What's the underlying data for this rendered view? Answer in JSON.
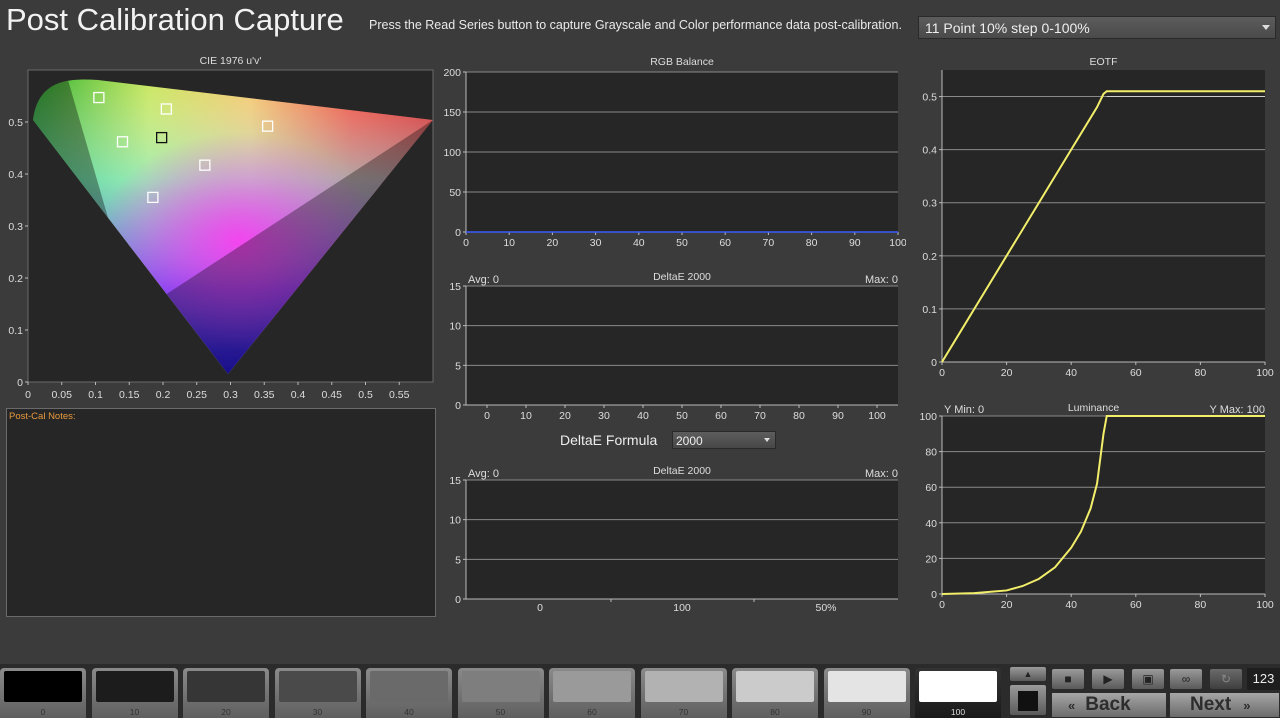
{
  "header": {
    "title": "Post Calibration Capture",
    "instruction": "Press the Read Series button to capture Grayscale and Color performance data post-calibration.",
    "series_select": "11 Point 10% step 0-100%"
  },
  "notes": {
    "label": "Post-Cal Notes:"
  },
  "deltae_formula": {
    "label": "DeltaE Formula",
    "value": "2000"
  },
  "colors": {
    "panel_bg": "#262626",
    "grid": "#8a8a8a",
    "curve": "#f2ee6a",
    "rgb_line": "#3a5cff",
    "notes_label": "#e89a3c"
  },
  "chart_data": [
    {
      "type": "scatter",
      "title": "CIE 1976 u'v'",
      "xticks": [
        "0",
        "0.05",
        "0.1",
        "0.15",
        "0.2",
        "0.25",
        "0.3",
        "0.35",
        "0.4",
        "0.45",
        "0.5",
        "0.55"
      ],
      "yticks": [
        "0",
        "0.1",
        "0.2",
        "0.3",
        "0.4",
        "0.5"
      ],
      "xlim": [
        0,
        0.6
      ],
      "ylim": [
        0,
        0.6
      ],
      "points": [
        {
          "u": 0.105,
          "v": 0.547
        },
        {
          "u": 0.205,
          "v": 0.525
        },
        {
          "u": 0.14,
          "v": 0.462
        },
        {
          "u": 0.198,
          "v": 0.47,
          "target": true
        },
        {
          "u": 0.355,
          "v": 0.492
        },
        {
          "u": 0.262,
          "v": 0.417
        },
        {
          "u": 0.185,
          "v": 0.355
        }
      ]
    },
    {
      "type": "line",
      "title": "RGB Balance",
      "xticks": [
        "0",
        "10",
        "20",
        "30",
        "40",
        "50",
        "60",
        "70",
        "80",
        "90",
        "100"
      ],
      "yticks": [
        "0",
        "50",
        "100",
        "150",
        "200"
      ],
      "xlim": [
        0,
        100
      ],
      "ylim": [
        0,
        200
      ],
      "series": [
        {
          "x": [
            0,
            100
          ],
          "y": [
            0,
            0
          ]
        }
      ]
    },
    {
      "type": "bar",
      "title": "DeltaE 2000",
      "avg_label": "Avg: 0",
      "max_label": "Max: 0",
      "xticks": [
        "0",
        "10",
        "20",
        "30",
        "40",
        "50",
        "60",
        "70",
        "80",
        "90",
        "100"
      ],
      "yticks": [
        "0",
        "5",
        "10",
        "15"
      ],
      "ylim": [
        0,
        15
      ],
      "values": [
        0,
        0,
        0,
        0,
        0,
        0,
        0,
        0,
        0,
        0,
        0
      ]
    },
    {
      "type": "bar",
      "title": "DeltaE 2000",
      "avg_label": "Avg: 0",
      "max_label": "Max: 0",
      "categories": [
        "0",
        "100",
        "50%"
      ],
      "yticks": [
        "0",
        "5",
        "10",
        "15"
      ],
      "ylim": [
        0,
        15
      ],
      "values": [
        0,
        0,
        0
      ]
    },
    {
      "type": "line",
      "title": "EOTF",
      "xticks": [
        "0",
        "20",
        "40",
        "60",
        "80",
        "100"
      ],
      "yticks": [
        "0",
        "0.1",
        "0.2",
        "0.3",
        "0.4",
        "0.5"
      ],
      "xlim": [
        0,
        100
      ],
      "ylim": [
        0,
        0.55
      ],
      "series": [
        {
          "x": [
            0,
            5,
            10,
            20,
            30,
            40,
            48,
            50,
            51,
            60,
            80,
            100
          ],
          "y": [
            0,
            0.05,
            0.1,
            0.2,
            0.3,
            0.4,
            0.48,
            0.505,
            0.51,
            0.51,
            0.51,
            0.51
          ]
        },
        {
          "x": [
            51,
            100
          ],
          "y": [
            0.5,
            0.5
          ]
        }
      ]
    },
    {
      "type": "line",
      "title": "Luminance",
      "ymin_label": "Y Min: 0",
      "ymax_label": "Y Max: 100",
      "xticks": [
        "0",
        "20",
        "40",
        "60",
        "80",
        "100"
      ],
      "yticks": [
        "0",
        "20",
        "40",
        "60",
        "80",
        "100"
      ],
      "xlim": [
        0,
        100
      ],
      "ylim": [
        0,
        100
      ],
      "series": [
        {
          "x": [
            0,
            10,
            20,
            25,
            30,
            35,
            40,
            43,
            46,
            48,
            50,
            51,
            60,
            80,
            100
          ],
          "y": [
            0,
            0.5,
            2,
            4.5,
            8.5,
            15,
            26,
            35,
            48,
            62,
            90,
            100,
            100,
            100,
            100
          ]
        }
      ]
    }
  ],
  "swatches": [
    {
      "label": "0",
      "color": "#000000"
    },
    {
      "label": "10",
      "color": "#1c1c1c"
    },
    {
      "label": "20",
      "color": "#363636"
    },
    {
      "label": "30",
      "color": "#4a4a4a"
    },
    {
      "label": "40",
      "color": "#6a6a6a"
    },
    {
      "label": "50",
      "color": "#7e7e7e"
    },
    {
      "label": "60",
      "color": "#9a9a9a"
    },
    {
      "label": "70",
      "color": "#b2b2b2"
    },
    {
      "label": "80",
      "color": "#cbcbcb"
    },
    {
      "label": "90",
      "color": "#e4e4e4"
    },
    {
      "label": "100",
      "color": "#ffffff",
      "active": true
    }
  ],
  "controls": {
    "counter": "123",
    "back_label": "Back",
    "next_label": "Next",
    "icons": [
      "stop-icon",
      "play-icon",
      "save-icon",
      "loop-icon",
      "refresh-icon"
    ]
  }
}
